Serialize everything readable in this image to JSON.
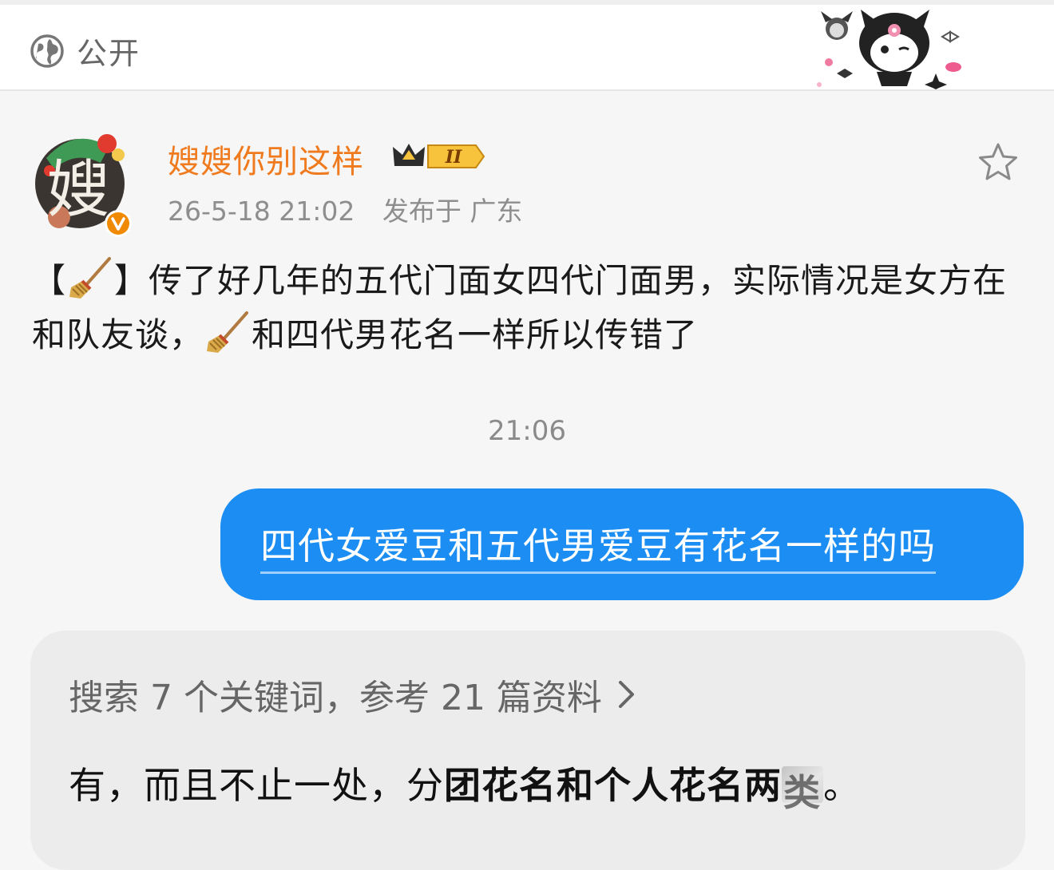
{
  "header": {
    "visibility_label": "公开"
  },
  "post": {
    "username": "嫂嫂你别这样",
    "rank_badge": "II",
    "avatar_char": "嫂",
    "timestamp": "26-5-18 21:02",
    "location": "发布于 广东",
    "text_prefix": "【",
    "text_part1": "】传了好几年的五代门面女四代门面男，实际情况是女方在和队友谈，",
    "text_part2": "和四代男花名一样所以传错了"
  },
  "chat": {
    "time_separator": "21:06",
    "user_message": "四代女爱豆和五代男爱豆有花名一样的吗",
    "search_summary": "搜索 7 个关键词，参考 21 篇资料",
    "answer_plain1": "有，而且不止一处，分",
    "answer_bold": "团花名和个人花名两",
    "answer_obscured": "类",
    "answer_end": "。"
  },
  "colors": {
    "username": "#f07a1e",
    "bubble": "#1c8ef3",
    "answer_card": "#ececec"
  },
  "icons": [
    "globe-icon",
    "kuromi-sticker",
    "crown-badge-icon",
    "star-icon",
    "broom-emoji",
    "chevron-right-icon"
  ]
}
